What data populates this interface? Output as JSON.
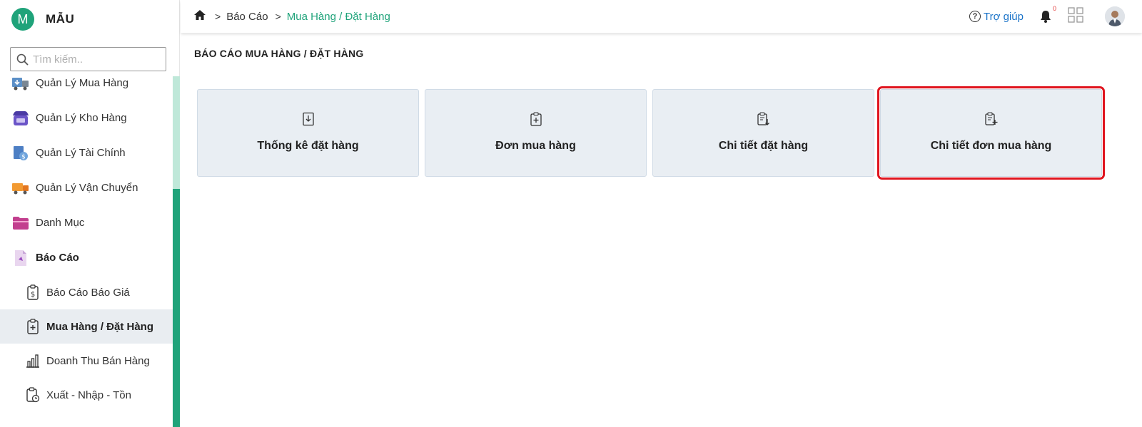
{
  "brand": {
    "logo_letter": "M",
    "name": "MẪU"
  },
  "search": {
    "placeholder": "Tìm kiếm.."
  },
  "sidebar": {
    "items": [
      {
        "label": "Quản Lý Mua Hàng",
        "icon": "truck-box-icon"
      },
      {
        "label": "Quản Lý Kho Hàng",
        "icon": "store-icon"
      },
      {
        "label": "Quản Lý Tài Chính",
        "icon": "finance-doc-icon"
      },
      {
        "label": "Quản Lý Vận Chuyển",
        "icon": "delivery-truck-icon"
      },
      {
        "label": "Danh Mục",
        "icon": "folder-icon"
      },
      {
        "label": "Báo Cáo",
        "icon": "report-file-icon"
      }
    ],
    "sub_items": [
      {
        "label": "Báo Cáo Báo Giá",
        "icon": "clipboard-dollar-icon"
      },
      {
        "label": "Mua Hàng / Đặt Hàng",
        "icon": "clipboard-plus-icon",
        "active": true
      },
      {
        "label": "Doanh Thu Bán Hàng",
        "icon": "bar-chart-icon"
      },
      {
        "label": "Xuất - Nhập - Tồn",
        "icon": "clipboard-clock-icon"
      }
    ]
  },
  "topbar": {
    "breadcrumb": [
      "Báo Cáo",
      "Mua Hàng / Đặt Hàng"
    ],
    "help_label": "Trợ giúp",
    "notification_count": "0"
  },
  "page": {
    "title": "BÁO CÁO MUA HÀNG / ĐẶT HÀNG",
    "cards": [
      {
        "label": "Thống kê đặt hàng",
        "icon": "download-doc-icon"
      },
      {
        "label": "Đơn mua hàng",
        "icon": "clipboard-plus-icon"
      },
      {
        "label": "Chi tiết đặt hàng",
        "icon": "clipboard-download-icon"
      },
      {
        "label": "Chi tiết đơn mua hàng",
        "icon": "clipboard-add-icon",
        "selected": true
      }
    ]
  },
  "colors": {
    "accent": "#1fa37a",
    "link": "#1a73c8",
    "highlight": "#e0141e",
    "card_bg": "#e9eef3"
  }
}
